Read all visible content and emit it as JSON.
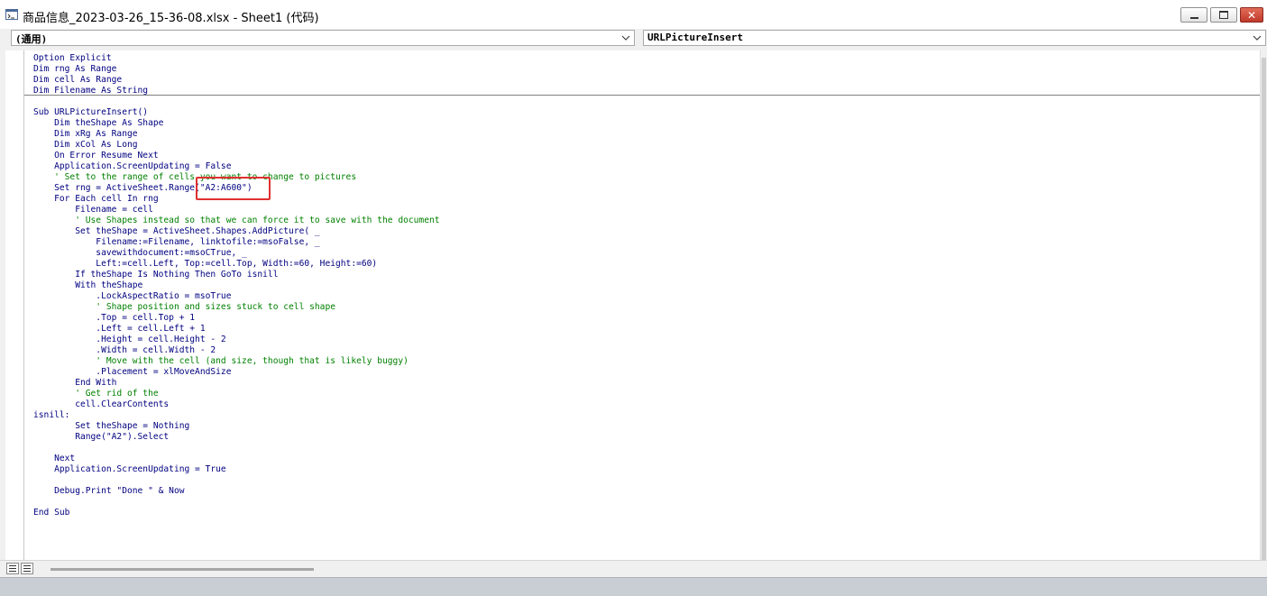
{
  "window": {
    "title": "商品信息_2023-03-26_15-36-08.xlsx - Sheet1 (代码)",
    "icon": "vba-code-window-icon",
    "buttons": {
      "minimize": "minimize-icon",
      "restore": "restore-icon",
      "close": "close-icon"
    }
  },
  "object_combo": {
    "value": "(通用)"
  },
  "procedure_combo": {
    "value": "URLPictureInsert"
  },
  "code_lines": [
    {
      "t": "Option Explicit"
    },
    {
      "t": "Dim rng As Range"
    },
    {
      "t": "Dim cell As Range"
    },
    {
      "t": "Dim Filename As String"
    },
    {
      "t": ""
    },
    {
      "t": "Sub URLPictureInsert()"
    },
    {
      "t": "    Dim theShape As Shape"
    },
    {
      "t": "    Dim xRg As Range"
    },
    {
      "t": "    Dim xCol As Long"
    },
    {
      "t": "    On Error Resume Next"
    },
    {
      "t": "    Application.ScreenUpdating = False"
    },
    {
      "t": "    ' Set to the range of cells you want to change to pictures",
      "comment": true
    },
    {
      "t": "    Set rng = ActiveSheet.Range(\"A2:A600\")"
    },
    {
      "t": "    For Each cell In rng"
    },
    {
      "t": "        Filename = cell"
    },
    {
      "t": "        ' Use Shapes instead so that we can force it to save with the document",
      "comment": true
    },
    {
      "t": "        Set theShape = ActiveSheet.Shapes.AddPicture( _"
    },
    {
      "t": "            Filename:=Filename, linktofile:=msoFalse, _"
    },
    {
      "t": "            savewithdocument:=msoCTrue, _"
    },
    {
      "t": "            Left:=cell.Left, Top:=cell.Top, Width:=60, Height:=60)"
    },
    {
      "t": "        If theShape Is Nothing Then GoTo isnill"
    },
    {
      "t": "        With theShape"
    },
    {
      "t": "            .LockAspectRatio = msoTrue"
    },
    {
      "t": "            ' Shape position and sizes stuck to cell shape",
      "comment": true
    },
    {
      "t": "            .Top = cell.Top + 1"
    },
    {
      "t": "            .Left = cell.Left + 1"
    },
    {
      "t": "            .Height = cell.Height - 2"
    },
    {
      "t": "            .Width = cell.Width - 2"
    },
    {
      "t": "            ' Move with the cell (and size, though that is likely buggy)",
      "comment": true
    },
    {
      "t": "            .Placement = xlMoveAndSize"
    },
    {
      "t": "        End With"
    },
    {
      "t": "        ' Get rid of the",
      "comment": true
    },
    {
      "t": "        cell.ClearContents"
    },
    {
      "t": "isnill:"
    },
    {
      "t": "        Set theShape = Nothing"
    },
    {
      "t": "        Range(\"A2\").Select"
    },
    {
      "t": ""
    },
    {
      "t": "    Next"
    },
    {
      "t": "    Application.ScreenUpdating = True"
    },
    {
      "t": ""
    },
    {
      "t": "    Debug.Print \"Done \" & Now"
    },
    {
      "t": ""
    },
    {
      "t": "End Sub"
    }
  ],
  "colors": {
    "code_text": "#000080",
    "comment": "#008000",
    "highlight_box": "#e03030"
  },
  "bottom": {
    "procedure_view_icon": "procedure-view-icon",
    "full_module_view_icon": "full-module-view-icon"
  }
}
